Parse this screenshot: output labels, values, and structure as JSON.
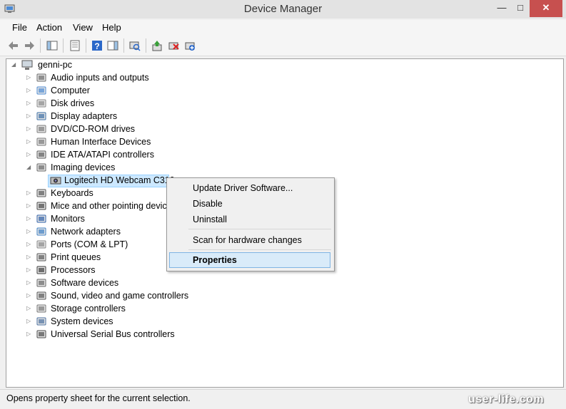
{
  "window": {
    "title": "Device Manager"
  },
  "menu": [
    "File",
    "Action",
    "View",
    "Help"
  ],
  "toolbar": [
    {
      "icon": "back-arrow-icon"
    },
    {
      "icon": "forward-arrow-icon"
    },
    {
      "icon": "show-hide-console-tree-icon"
    },
    {
      "icon": "properties-icon"
    },
    {
      "icon": "help-icon"
    },
    {
      "icon": "show-action-pane-icon"
    },
    {
      "icon": "scan-hardware-changes-icon"
    },
    {
      "icon": "update-driver-icon"
    },
    {
      "icon": "uninstall-device-icon"
    },
    {
      "icon": "add-legacy-hardware-icon"
    }
  ],
  "tree": {
    "root": "genni-pc",
    "categories": [
      "Audio inputs and outputs",
      "Computer",
      "Disk drives",
      "Display adapters",
      "DVD/CD-ROM drives",
      "Human Interface Devices",
      "IDE ATA/ATAPI controllers",
      "Imaging devices",
      "Keyboards",
      "Mice and other pointing devices",
      "Monitors",
      "Network adapters",
      "Ports (COM & LPT)",
      "Print queues",
      "Processors",
      "Software devices",
      "Sound, video and game controllers",
      "Storage controllers",
      "System devices",
      "Universal Serial Bus controllers"
    ],
    "expanded": "Imaging devices",
    "selected_device": "Logitech HD Webcam C310"
  },
  "context_menu": {
    "items": [
      "Update Driver Software...",
      "Disable",
      "Uninstall",
      "Scan for hardware changes",
      "Properties"
    ],
    "highlighted": "Properties"
  },
  "status": "Opens property sheet for the current selection.",
  "watermark": "user-life.com",
  "colors": {
    "selection": "#cce8ff",
    "close_button": "#c7504f",
    "menu_highlight": "#d9ebf9"
  }
}
